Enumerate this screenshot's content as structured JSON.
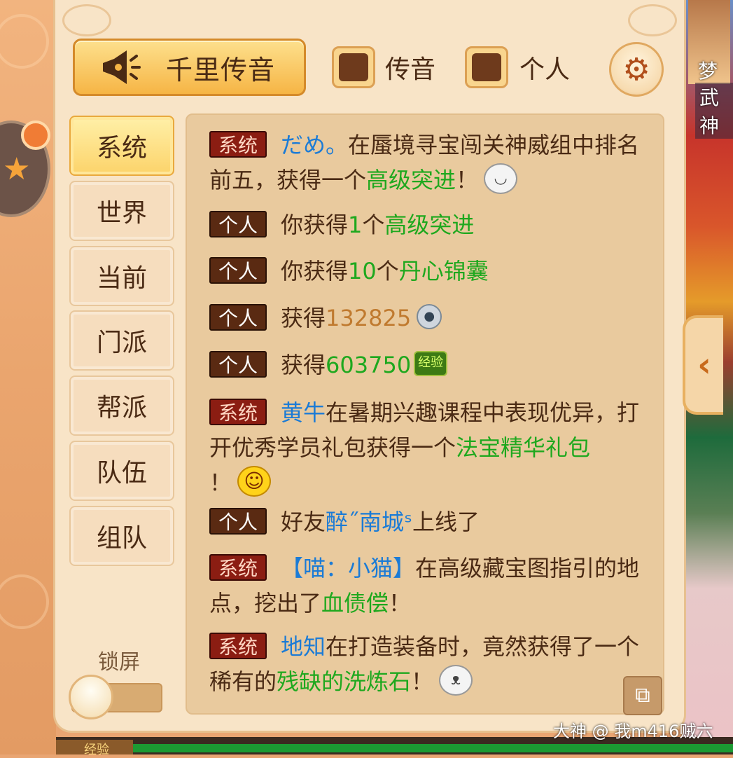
{
  "header": {
    "broadcast_label": "千里传音",
    "filters": [
      {
        "label": "传音",
        "checked": true
      },
      {
        "label": "个人",
        "checked": true
      }
    ]
  },
  "background": {
    "right_names": [
      "梦",
      "武神"
    ]
  },
  "tabs": [
    {
      "label": "系统",
      "active": true
    },
    {
      "label": "世界",
      "active": false
    },
    {
      "label": "当前",
      "active": false
    },
    {
      "label": "门派",
      "active": false
    },
    {
      "label": "帮派",
      "active": false
    },
    {
      "label": "队伍",
      "active": false
    },
    {
      "label": "组队",
      "active": false
    }
  ],
  "lock": {
    "label": "锁屏",
    "on": false
  },
  "tags": {
    "system": "系统",
    "personal": "个人"
  },
  "messages": [
    {
      "type": "system",
      "parts": [
        "だめ。",
        "在蜃境寻宝闯关神威组中排名前五，获得一个",
        "高级突进",
        "！"
      ]
    },
    {
      "type": "personal",
      "parts": [
        "你获得",
        "1",
        "个",
        "高级突进"
      ]
    },
    {
      "type": "personal",
      "parts": [
        "你获得",
        "10",
        "个",
        "丹心锦囊"
      ]
    },
    {
      "type": "personal",
      "parts": [
        "获得",
        "132825"
      ]
    },
    {
      "type": "personal",
      "parts": [
        "获得",
        "603750",
        "经验"
      ]
    },
    {
      "type": "system",
      "parts": [
        "黄牛",
        "在暑期兴趣课程中表现优异，打开优秀学员礼包获得一个",
        "法宝精华礼包",
        "！"
      ]
    },
    {
      "type": "personal",
      "parts": [
        "好友",
        "醉˝南城ˢ",
        "上线了"
      ]
    },
    {
      "type": "system",
      "parts": [
        "【喵：小猫】",
        "在高级藏宝图指引的地点，挖出了",
        "血债偿",
        "！"
      ]
    },
    {
      "type": "system",
      "parts": [
        "地知",
        "在打造装备时，竟然获得了一个稀有的",
        "残缺的洗炼石",
        "！"
      ]
    }
  ],
  "bottom": {
    "exp_label": "经验"
  },
  "watermark": "大神 @ 我m416贼六",
  "colors": {
    "system_tag": "#8b1d12",
    "personal_tag": "#5a2a12",
    "player_name": "#1b7bd6",
    "item_name": "#1ea81e",
    "silver_amount": "#c07a2f"
  }
}
